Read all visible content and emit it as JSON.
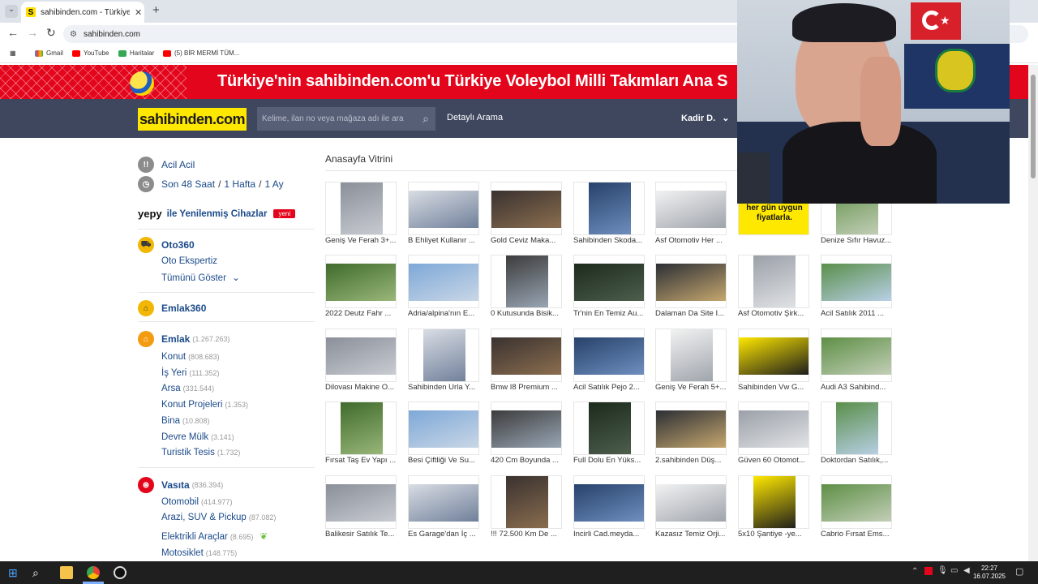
{
  "browser": {
    "tab_title": "sahibinden.com - Türkiye'nin Ö…",
    "tab_favicon": "S",
    "url": "sahibinden.com",
    "bookmarks": [
      "Gmail",
      "YouTube",
      "Haritalar",
      "(5) BİR MERMİ TÜM..."
    ]
  },
  "banner": {
    "text": "Türkiye'nin sahibinden.com'u Türkiye Voleybol Milli Takımları Ana S"
  },
  "header": {
    "logo": "sahibinden.com",
    "search_placeholder": "Kelime, ilan no veya mağaza adı ile ara",
    "detailed_search": "Detaylı Arama",
    "user": "Kadir D."
  },
  "sidebar": {
    "acil": "Acil Acil",
    "time_links": [
      "Son 48 Saat",
      "1 Hafta",
      "1 Ay"
    ],
    "time_sep": "/",
    "yepy_logo": "yepy",
    "yepy_label": "ile Yenilenmiş Cihazlar",
    "yepy_badge": "yeni",
    "oto360": "Oto360",
    "oto_ekspertiz": "Oto Ekspertiz",
    "show_all": "Tümünü Göster",
    "emlak360": "Emlak360",
    "emlak": {
      "label": "Emlak",
      "count": "(1.267.263)"
    },
    "emlak_items": [
      {
        "label": "Konut",
        "count": "(808.683)"
      },
      {
        "label": "İş Yeri",
        "count": "(111.352)"
      },
      {
        "label": "Arsa",
        "count": "(331.544)"
      },
      {
        "label": "Konut Projeleri",
        "count": "(1.353)"
      },
      {
        "label": "Bina",
        "count": "(10.808)"
      },
      {
        "label": "Devre Mülk",
        "count": "(3.141)"
      },
      {
        "label": "Turistik Tesis",
        "count": "(1.732)"
      }
    ],
    "vasita": {
      "label": "Vasıta",
      "count": "(836.394)"
    },
    "vasita_items": [
      {
        "label": "Otomobil",
        "count": "(414.977)"
      },
      {
        "label": "Arazi, SUV & Pickup",
        "count": "(87.082)"
      },
      {
        "label": "Elektrikli Araçlar",
        "count": "(8.695)"
      },
      {
        "label": "Motosiklet",
        "count": "(148.775)"
      }
    ]
  },
  "vitrin": {
    "title": "Anasayfa Vitrini",
    "promo_text": "her gün uygun fiyatlarla.",
    "rows": [
      [
        "Geniş Ve Ferah 3+...",
        "B Ehliyet Kullanır ...",
        "Gold Ceviz Maka...",
        "Sahibinden Skoda...",
        "Asf Otomotiv Her ...",
        "",
        "Denize Sıfır Havuz..."
      ],
      [
        "2022 Deutz Fahr ...",
        "Adria/alpina'nın E...",
        "0 Kutusunda Bisik...",
        "Tr'nin En Temiz Au...",
        "Dalaman Da Site I...",
        "Asf Otomotiv Şirk...",
        "Acil Satılık 2011 ..."
      ],
      [
        "Dilovası Makine O...",
        "Sahibinden Urla Y...",
        "Bmw I8 Premium ...",
        "Acil Satılık Pejo 2...",
        "Geniş Ve Ferah 5+...",
        "Sahibinden Vw G...",
        "Audi A3 Sahibind..."
      ],
      [
        "Fırsat Taş Ev Yapı ...",
        "Besi Çiftliği Ve Su...",
        "420 Cm Boyunda ...",
        "Full Dolu En Yüks...",
        "2.sahibinden Düş...",
        "Güven 60 Otomot...",
        "Doktordan Satılık,..."
      ],
      [
        "Balikesir Satılık Te...",
        "Es Garage'dan İç ...",
        "!!! 72.500 Km De ...",
        "Incirli Cad.meyda...",
        "Kazasız Temiz Orji...",
        "5x10 Şantiye -ye...",
        "Cabrio Fırsat Ems..."
      ]
    ]
  },
  "taskbar": {
    "time": "22:27",
    "date": "16.07.2025"
  },
  "colors": {
    "brand_yellow": "#ffe800",
    "header_bg": "#3f475f",
    "banner_red": "#e3051b",
    "link_blue": "#1b4a8a"
  }
}
